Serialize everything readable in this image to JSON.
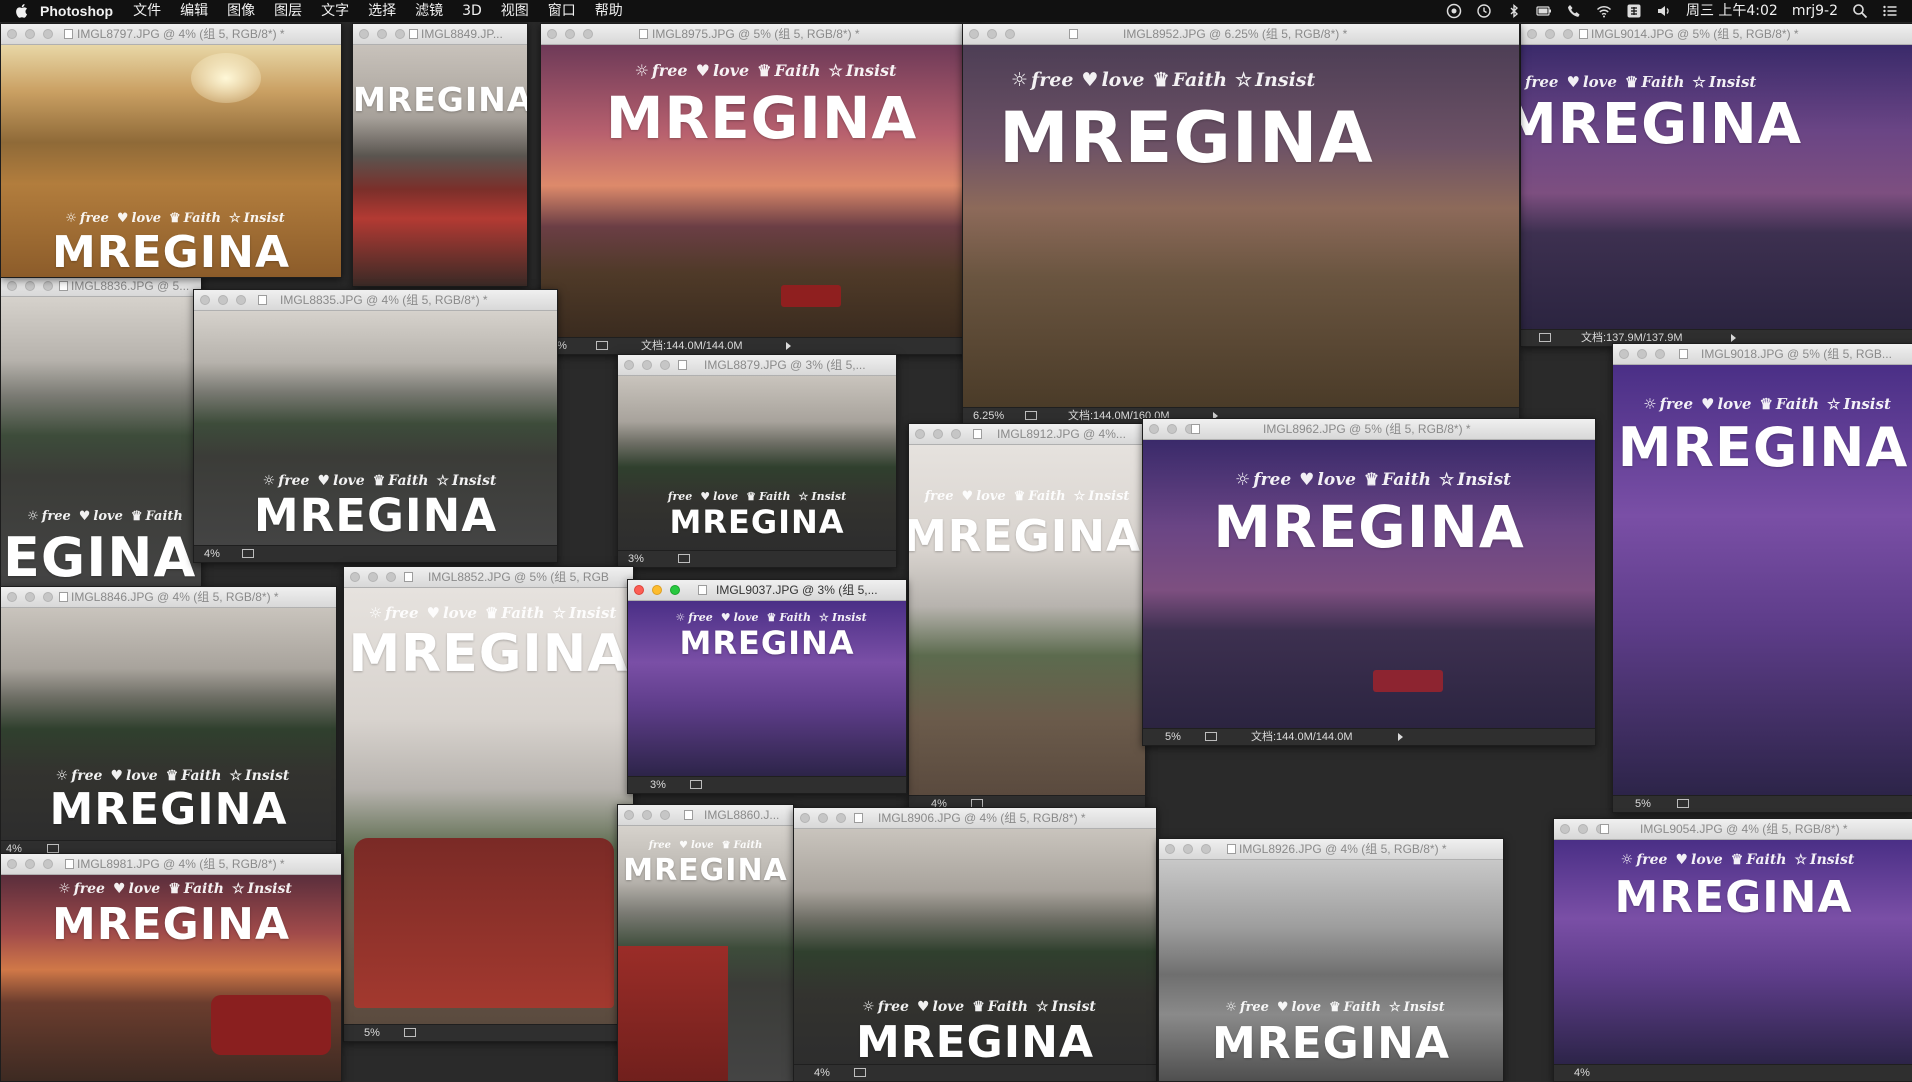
{
  "menubar": {
    "app_name": "Photoshop",
    "items": [
      "文件",
      "编辑",
      "图像",
      "图层",
      "文字",
      "选择",
      "滤镜",
      "3D",
      "视图",
      "窗口",
      "帮助"
    ],
    "clock": "周三 上午4:02",
    "user": "mrj9-2"
  },
  "overlay": {
    "tag_free": "free",
    "tag_love": "love",
    "tag_faith": "Faith",
    "tag_insist": "Insist",
    "brand": "MREGINA"
  },
  "windows": [
    {
      "title": "IMGL8797.JPG @ 4% (组 5, RGB/8*) *"
    },
    {
      "title": "IMGL8849.JP..."
    },
    {
      "title": "IMGL8975.JPG @ 5% (组 5, RGB/8*) *",
      "zoom": "5%",
      "doc": "文档:144.0M/144.0M"
    },
    {
      "title": "IMGL8952.JPG @ 6.25% (组 5, RGB/8*) *",
      "zoom": "6.25%",
      "doc": "文档:144.0M/160.0M"
    },
    {
      "title": "IMGL9014.JPG @ 5% (组 5, RGB/8*) *",
      "doc": "文档:137.9M/137.9M"
    },
    {
      "title": "IMGL8836.JPG @ 5..."
    },
    {
      "title": "IMGL8835.JPG @ 4% (组 5, RGB/8*) *",
      "zoom": "4%"
    },
    {
      "title": "IMGL8879.JPG @ 3% (组 5,...",
      "zoom": "3%"
    },
    {
      "title": "IMGL8912.JPG @ 4%...",
      "zoom": "4%"
    },
    {
      "title": "IMGL8962.JPG @ 5% (组 5, RGB/8*) *",
      "zoom": "5%",
      "doc": "文档:144.0M/144.0M"
    },
    {
      "title": "IMGL9018.JPG @ 5% (组 5, RGB...",
      "zoom": "5%"
    },
    {
      "title": "IMGL8846.JPG @ 4% (组 5, RGB/8*) *",
      "zoom": "4%"
    },
    {
      "title": "IMGL8852.JPG @ 5% (组 5, RGB",
      "zoom": "5%"
    },
    {
      "title": "IMGL9037.JPG @ 3% (组 5,...",
      "zoom": "3%"
    },
    {
      "title": "IMGL8860.J..."
    },
    {
      "title": "IMGL8906.JPG @ 4% (组 5, RGB/8*) *",
      "zoom": "4%"
    },
    {
      "title": "IMGL8926.JPG @ 4% (组 5, RGB/8*) *"
    },
    {
      "title": "IMGL8981.JPG @ 4% (组 5, RGB/8*) *"
    },
    {
      "title": "IMGL9054.JPG @ 4% (组 5, RGB/8*) *",
      "zoom": "4%"
    }
  ],
  "colors": {
    "desktop": "#2a2a2a",
    "titlebar": "#e4e4e4",
    "statusbar": "#2f2f2f",
    "close": "#fc5e55",
    "minimize": "#fdbc2e",
    "zoom": "#28c840"
  }
}
